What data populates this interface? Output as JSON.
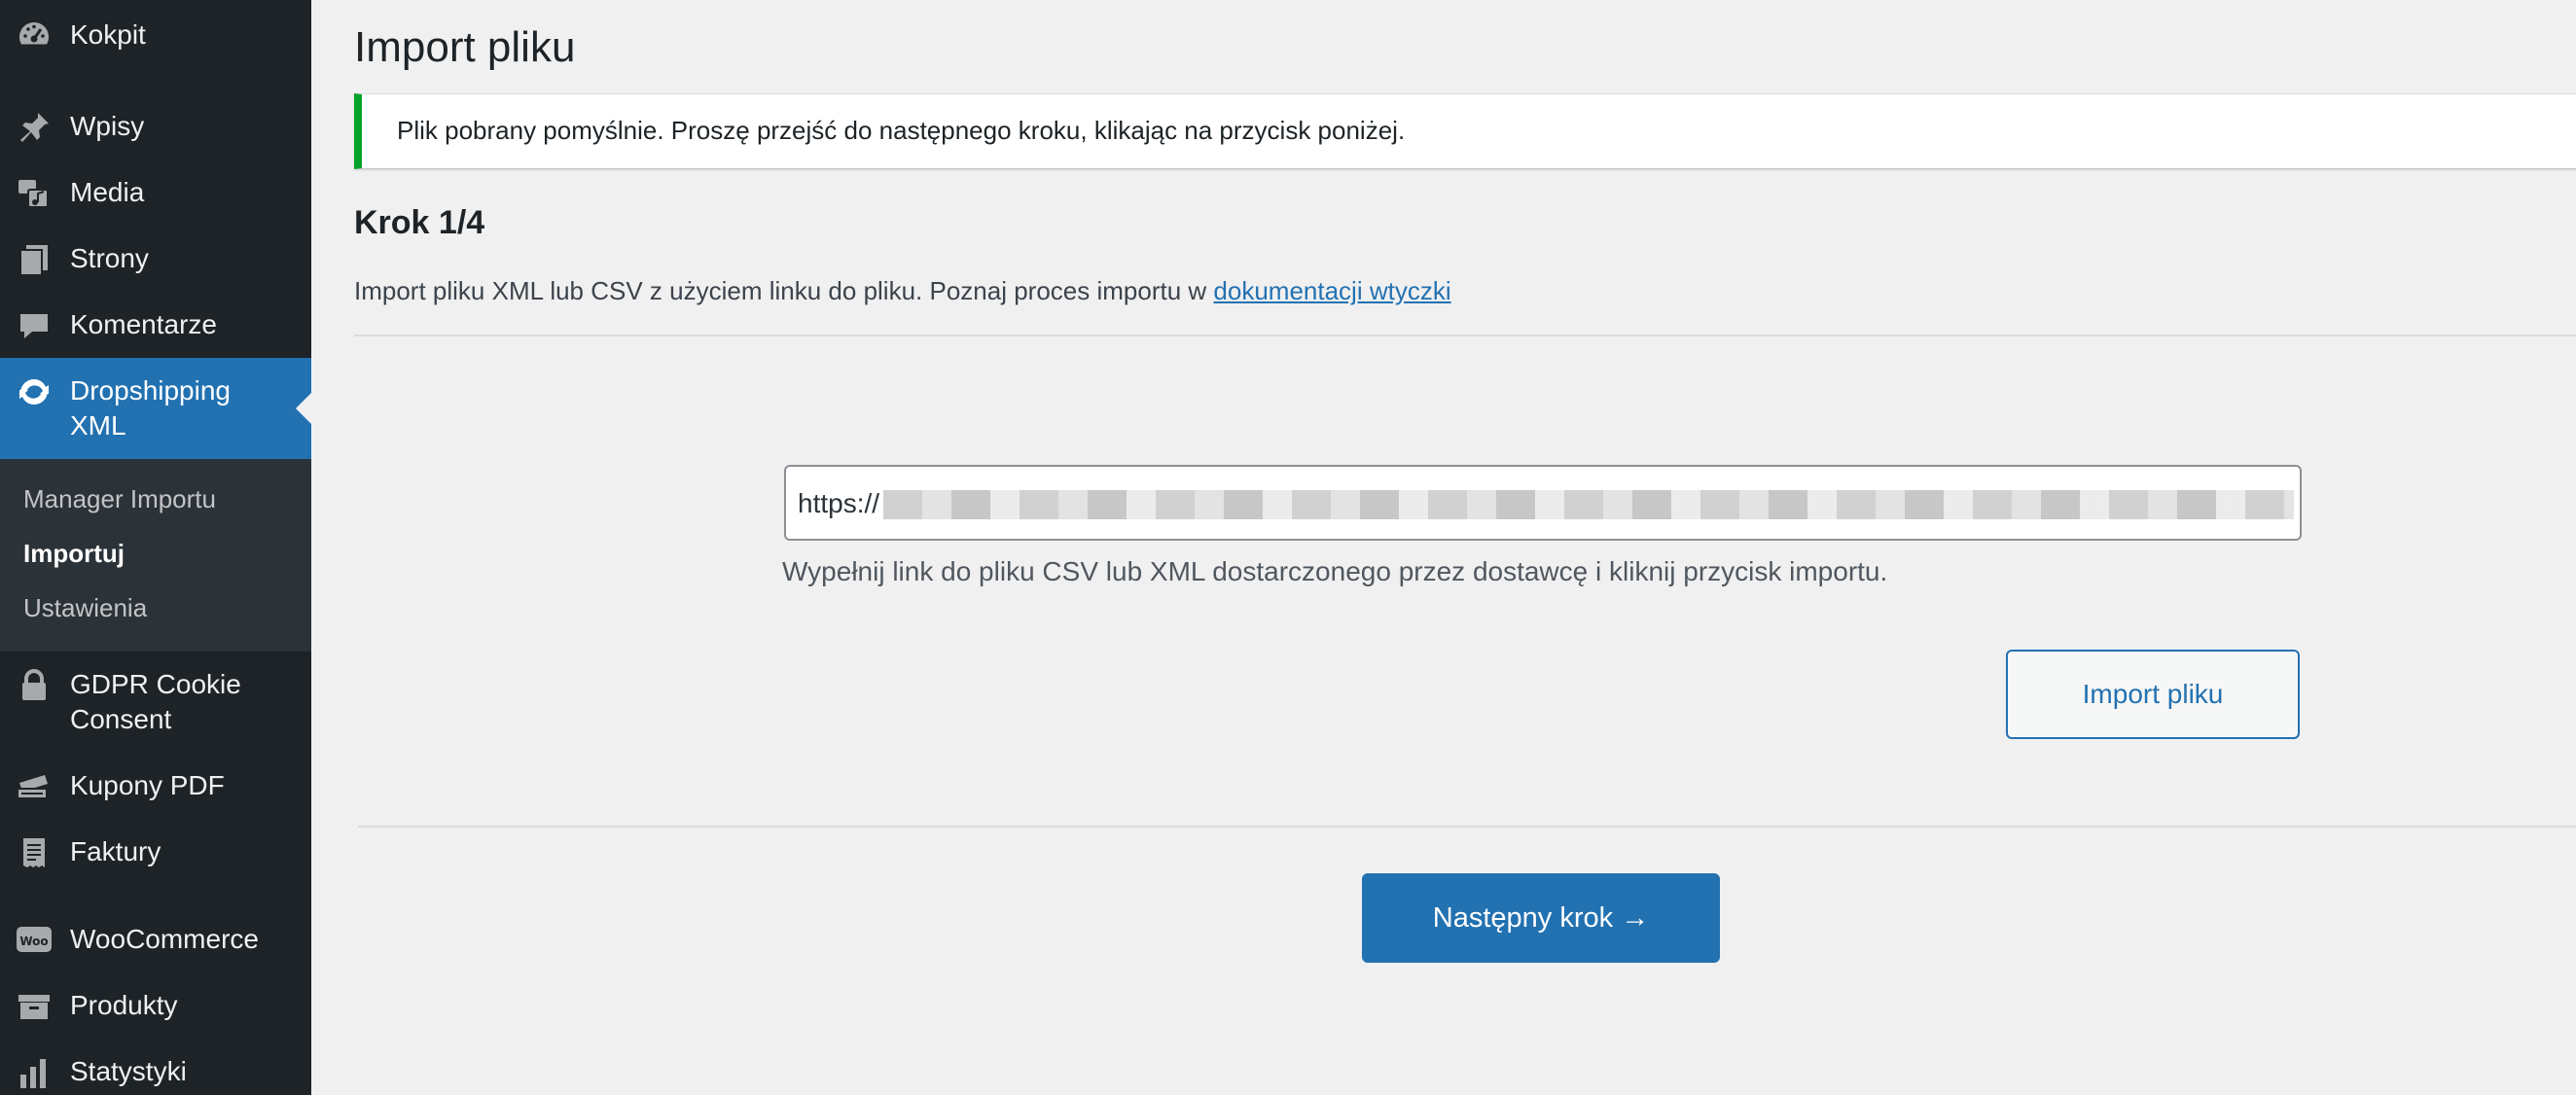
{
  "sidebar": {
    "items": [
      {
        "label": "Kokpit",
        "icon": "dashboard-icon"
      },
      {
        "label": "Wpisy",
        "icon": "pin-icon"
      },
      {
        "label": "Media",
        "icon": "media-icon"
      },
      {
        "label": "Strony",
        "icon": "pages-icon"
      },
      {
        "label": "Komentarze",
        "icon": "comments-icon"
      },
      {
        "label": "Dropshipping XML",
        "icon": "sync-icon",
        "current": true
      },
      {
        "label": "GDPR Cookie Consent",
        "icon": "lock-icon"
      },
      {
        "label": "Kupony PDF",
        "icon": "tickets-icon"
      },
      {
        "label": "Faktury",
        "icon": "invoice-icon"
      },
      {
        "label": "WooCommerce",
        "icon": "woo-icon"
      },
      {
        "label": "Produkty",
        "icon": "archive-icon"
      },
      {
        "label": "Statystyki",
        "icon": "chart-bar-icon"
      }
    ],
    "submenu": [
      {
        "label": "Manager Importu"
      },
      {
        "label": "Importuj",
        "active": true
      },
      {
        "label": "Ustawienia"
      }
    ]
  },
  "main": {
    "title": "Import pliku",
    "notice": "Plik pobrany pomyślnie. Proszę przejść do następnego kroku, klikając na przycisk poniżej.",
    "step_title": "Krok 1/4",
    "step_description": "Import pliku XML lub CSV z użyciem linku do pliku. Poznaj proces importu w",
    "doc_link": "dokumentacji wtyczki",
    "url_value": "https://",
    "url_help": "Wypełnij link do pliku CSV lub XML dostarczonego przez dostawcę i kliknij przycisk importu.",
    "import_button": "Import pliku",
    "next_button": "Następny krok →"
  },
  "colors": {
    "sidebar_bg": "#1d2327",
    "accent": "#2271b1",
    "notice_success": "#00a32a"
  }
}
